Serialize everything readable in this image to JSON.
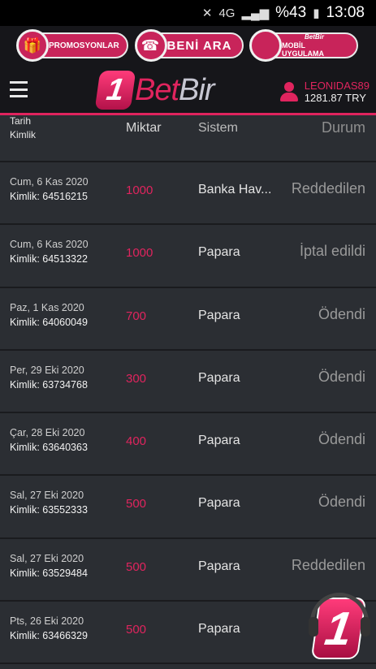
{
  "status_bar": {
    "network": "4G",
    "battery": "%43",
    "time": "13:08"
  },
  "promo": {
    "promo_label": "PROMOSYONLAR",
    "call_label": "BENİ ARA",
    "app_brand": "BetBir",
    "app_label": "MOBİL UYGULAMA"
  },
  "header": {
    "logo_mark": "1",
    "logo_word_1": "Bet",
    "logo_word_2": "Bir",
    "username": "LEONIDAS89",
    "balance": "1281.87 TRY"
  },
  "table": {
    "headers": {
      "date": "Tarih",
      "id": "Kimlik",
      "amount": "Miktar",
      "system": "Sistem",
      "status": "Durum"
    },
    "rows": [
      {
        "date": "Cum, 6 Kas 2020",
        "id": "Kimlik: 64516215",
        "amount": "1000",
        "system": "Banka Hav...",
        "status": "Reddedilen"
      },
      {
        "date": "Cum, 6 Kas 2020",
        "id": "Kimlik: 64513322",
        "amount": "1000",
        "system": "Papara",
        "status": "İptal edildi"
      },
      {
        "date": "Paz, 1 Kas 2020",
        "id": "Kimlik: 64060049",
        "amount": "700",
        "system": "Papara",
        "status": "Ödendi"
      },
      {
        "date": "Per, 29 Eki 2020",
        "id": "Kimlik: 63734768",
        "amount": "300",
        "system": "Papara",
        "status": "Ödendi"
      },
      {
        "date": "Çar, 28 Eki 2020",
        "id": "Kimlik: 63640363",
        "amount": "400",
        "system": "Papara",
        "status": "Ödendi"
      },
      {
        "date": "Sal, 27 Eki 2020",
        "id": "Kimlik: 63552333",
        "amount": "500",
        "system": "Papara",
        "status": "Ödendi"
      },
      {
        "date": "Sal, 27 Eki 2020",
        "id": "Kimlik: 63529484",
        "amount": "500",
        "system": "Papara",
        "status": "Reddedilen"
      },
      {
        "date": "Pts, 26 Eki 2020",
        "id": "Kimlik: 63466329",
        "amount": "500",
        "system": "Papara",
        "status": ""
      }
    ]
  },
  "support_badge": "1"
}
